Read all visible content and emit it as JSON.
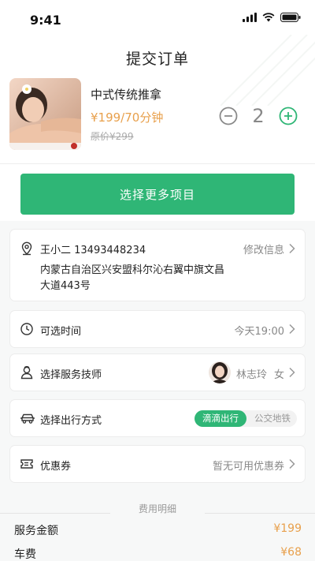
{
  "status_bar": {
    "time": "9:41"
  },
  "header": {
    "title": "提交订单"
  },
  "product": {
    "name": "中式传统推拿",
    "price": "¥199/70分钟",
    "original_price": "原价¥299",
    "quantity": "2"
  },
  "actions": {
    "more_items_label": "选择更多项目"
  },
  "address": {
    "name_phone": "王小二   13493448234",
    "edit_label": "修改信息",
    "line1": "内蒙古自治区兴安盟科尔沁右翼中旗文昌",
    "line2": "大道443号"
  },
  "time_slot": {
    "label": "可选时间",
    "value": "今天19:00"
  },
  "technician": {
    "label": "选择服务技师",
    "name": "林志玲",
    "gender": "女"
  },
  "transport": {
    "label": "选择出行方式",
    "active_option": "滴滴出行",
    "inactive_option": "公交地铁"
  },
  "coupon": {
    "label": "优惠券",
    "value": "暂无可用优惠券"
  },
  "fees": {
    "title": "费用明细",
    "rows": [
      {
        "label": "服务金额",
        "value": "¥199"
      },
      {
        "label": "车费",
        "value": "¥68"
      }
    ]
  },
  "colors": {
    "accent": "#2fb676",
    "price": "#e8a04c"
  },
  "icons": [
    "location-icon",
    "clock-icon",
    "technician-icon",
    "car-icon",
    "coupon-icon",
    "minus-icon",
    "plus-icon",
    "chevron-right-icon"
  ]
}
